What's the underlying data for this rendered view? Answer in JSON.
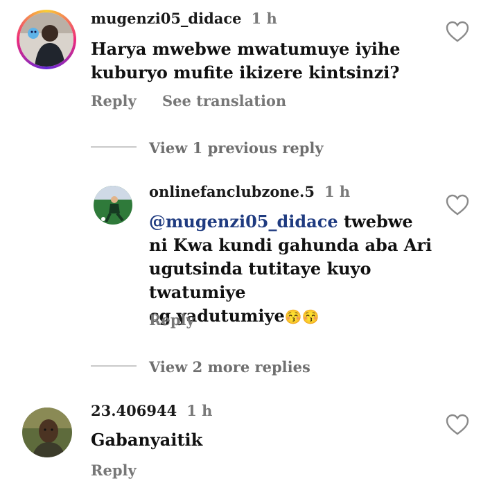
{
  "comments": [
    {
      "username": "mugenzi05_didace",
      "time": "1 h",
      "text": "Harya mwebwe mwatumuye iyihe kuburyo mufite ikizere kintsinzi?",
      "reply_label": "Reply",
      "translate_label": "See translation"
    },
    {
      "username": "23.406944",
      "time": "1 h",
      "text": "Gabanyaitik",
      "reply_label": "Reply"
    }
  ],
  "view_previous": "View 1 previous reply",
  "reply": {
    "username": "onlinefanclubzone.5",
    "time": "1 h",
    "mention": "@mugenzi05_didace",
    "line1": " twebwe",
    "line2": "ni Kwa kundi gahunda aba Ari",
    "line3": "ugutsinda tutitaye kuyo twatumiye",
    "line4": "cg yadutumiye",
    "emojis": "😚😚",
    "reply_label": "Reply"
  },
  "view_more": "View 2 more replies",
  "icons": {
    "like": "heart-icon"
  }
}
